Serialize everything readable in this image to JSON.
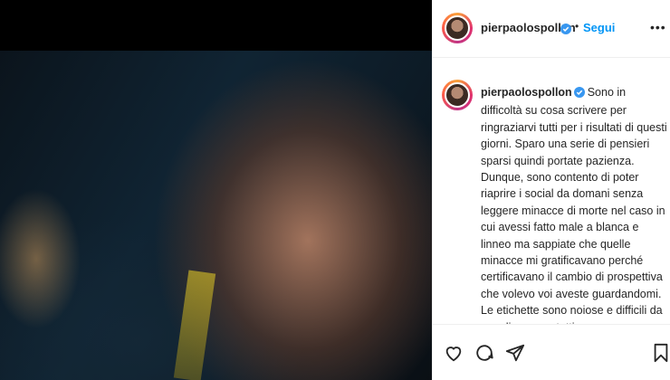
{
  "post": {
    "username": "pierpaolospollon",
    "follow_label": "Segui",
    "dot": "•",
    "more": "•••",
    "caption": "Sono in difficoltà su cosa scrivere per ringraziarvi tutti per i risultati di questi giorni. Sparo una serie di pensieri sparsi quindi portate pazienza. Dunque, sono contento di poter riaprire i social da domani senza leggere minacce di morte nel caso in cui avessi fatto male a blanca e linneo ma sappiate che quelle minacce mi gratificavano perché certificavano il cambio di prospettiva che volevo voi aveste guardandomi. Le etichette sono noiose e difficili da scardinare per tutti,"
  },
  "colors": {
    "follow": "#0095f6",
    "verified": "#3897f0",
    "text": "#262626"
  },
  "icons": {
    "like": "heart-icon",
    "comment": "comment-icon",
    "share": "paper-plane-icon",
    "save": "bookmark-icon",
    "verified": "verified-badge-icon",
    "more": "more-options-icon"
  }
}
